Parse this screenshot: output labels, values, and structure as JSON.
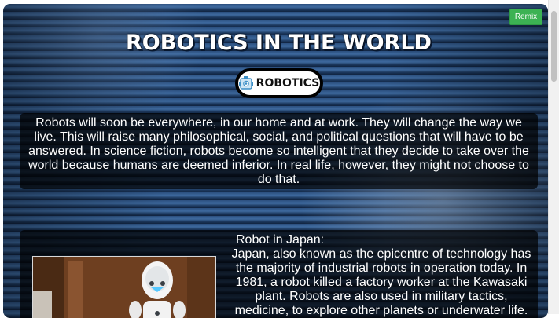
{
  "header": {
    "title": "ROBOTICS IN THE WORLD",
    "logo_text": "ROBOTICS",
    "remix_label": "Remix"
  },
  "intro": {
    "text": "Robots will soon be everywhere, in our home and at work. They will change the way we live. This will raise many philosophical, social, and political questions that will have to be answered. In science fiction, robots become so intelligent that they decide to take over the world because humans are deemed inferior. In real life, however, they might not choose to do that."
  },
  "japan_section": {
    "heading": "Robot in Japan:",
    "body": "Japan, also known as the epicentre of technology has the majority of industrial robots in operation today. In 1981, a robot killed a factory worker at the Kawasaki plant. Robots are also used in military tactics, medicine, to explore other planets or underwater life. The US"
  },
  "colors": {
    "remix_button": "#3cb253",
    "background_blue": "#2b4f7e",
    "panel": "rgba(0,0,0,0.72)"
  },
  "icons": {
    "logo": "robot-face-icon"
  }
}
